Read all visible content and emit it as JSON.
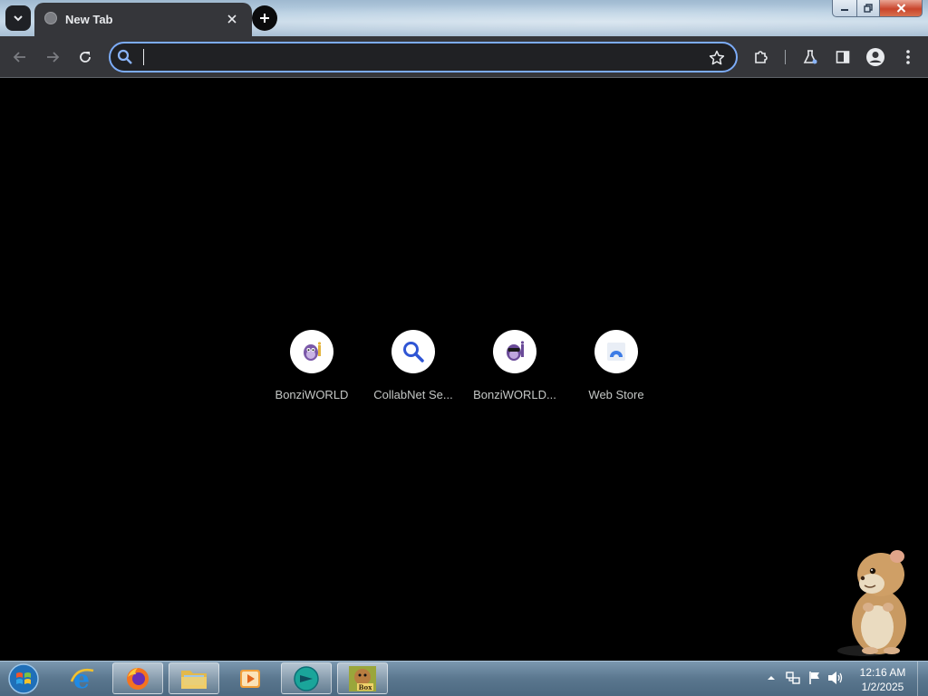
{
  "browser": {
    "tab": {
      "title": "New Tab",
      "close_icon": "close-icon"
    },
    "tab_search_icon": "chevron-down-icon",
    "new_tab_icon": "plus-icon",
    "window_controls": {
      "minimize": "minimize-icon",
      "maximize": "restore-icon",
      "close": "close-icon"
    },
    "toolbar": {
      "back_icon": "arrow-left-icon",
      "forward_icon": "arrow-right-icon",
      "reload_icon": "reload-icon",
      "omnibox": {
        "value": "",
        "placeholder": "",
        "search_icon": "search-icon",
        "bookmark_icon": "star-icon"
      },
      "extensions_icon": "puzzle-icon",
      "labs_icon": "flask-icon",
      "side_panel_icon": "side-panel-icon",
      "profile_icon": "profile-icon",
      "menu_icon": "kebab-menu-icon"
    }
  },
  "new_tab_page": {
    "shortcuts": [
      {
        "label": "BonziWORLD",
        "icon": "bonzi-icon"
      },
      {
        "label": "CollabNet Se...",
        "icon": "search-icon"
      },
      {
        "label": "BonziWORLD...",
        "icon": "bonzi-icon"
      },
      {
        "label": "Web Store",
        "icon": "web-store-icon"
      }
    ],
    "desktop_pet": "hamster"
  },
  "taskbar": {
    "start_icon": "windows-start-icon",
    "items": [
      {
        "name": "internet-explorer",
        "icon": "ie-icon",
        "active": false
      },
      {
        "name": "firefox",
        "icon": "firefox-icon",
        "active": true
      },
      {
        "name": "file-explorer",
        "icon": "folder-icon",
        "active": true
      },
      {
        "name": "media-player",
        "icon": "media-player-icon",
        "active": false
      },
      {
        "name": "chrome-canary-like",
        "icon": "browser-icon",
        "active": true
      },
      {
        "name": "box-app",
        "icon": "box-app-icon",
        "active": true
      }
    ],
    "tray": {
      "show_hidden_icon": "chevron-up-icon",
      "network_icon": "network-icon",
      "flag_icon": "action-center-flag-icon",
      "volume_icon": "speaker-icon",
      "time": "12:16 AM",
      "date": "1/2/2025"
    }
  },
  "colors": {
    "tab_bg": "#35363a",
    "omnibox_border": "#7cacf8",
    "ntp_bg": "#000000",
    "tile_label": "#c4c7c5"
  }
}
